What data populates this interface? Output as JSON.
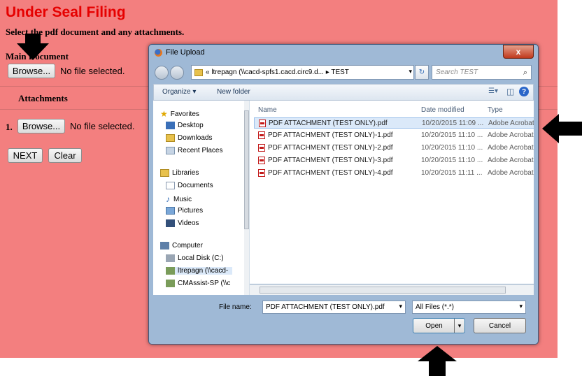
{
  "page": {
    "title": "Under Seal Filing",
    "instruction": "Select the pdf document and any attachments.",
    "main_document_label": "Main Document",
    "browse_label": "Browse...",
    "no_file_text": "No file selected.",
    "attachments_label": "Attachments",
    "attachment_number": "1.",
    "next_label": "NEXT",
    "clear_label": "Clear",
    "background_color": "#f37f7f",
    "title_color": "#e60000"
  },
  "dialog": {
    "title": "File Upload",
    "close_label": "x",
    "address": "« ltrepagn (\\\\cacd-spfs1.cacd.circ9.d... ▸ TEST",
    "search_placeholder": "Search TEST",
    "toolbar": {
      "organize": "Organize ▾",
      "new_folder": "New folder"
    },
    "nav": {
      "favorites": "Favorites",
      "favorites_items": [
        "Desktop",
        "Downloads",
        "Recent Places"
      ],
      "libraries": "Libraries",
      "libraries_items": [
        "Documents",
        "Music",
        "Pictures",
        "Videos"
      ],
      "computer": "Computer",
      "computer_items": [
        "Local Disk (C:)",
        "ltrepagn (\\\\cacd-",
        "CMAssist-SP (\\\\c"
      ]
    },
    "columns": {
      "name": "Name",
      "date": "Date modified",
      "type": "Type"
    },
    "files": [
      {
        "name": "PDF ATTACHMENT (TEST ONLY).pdf",
        "date": "10/20/2015 11:09 ...",
        "type": "Adobe Acrobat D",
        "selected": true
      },
      {
        "name": "PDF ATTACHMENT (TEST ONLY)-1.pdf",
        "date": "10/20/2015 11:10 ...",
        "type": "Adobe Acrobat D",
        "selected": false
      },
      {
        "name": "PDF ATTACHMENT (TEST ONLY)-2.pdf",
        "date": "10/20/2015 11:10 ...",
        "type": "Adobe Acrobat D",
        "selected": false
      },
      {
        "name": "PDF ATTACHMENT (TEST ONLY)-3.pdf",
        "date": "10/20/2015 11:10 ...",
        "type": "Adobe Acrobat D",
        "selected": false
      },
      {
        "name": "PDF ATTACHMENT (TEST ONLY)-4.pdf",
        "date": "10/20/2015 11:11 ...",
        "type": "Adobe Acrobat D",
        "selected": false
      }
    ],
    "file_name_label": "File name:",
    "file_name_value": "PDF ATTACHMENT (TEST ONLY).pdf",
    "file_type_filter": "All Files (*.*)",
    "open_label": "Open",
    "cancel_label": "Cancel"
  }
}
